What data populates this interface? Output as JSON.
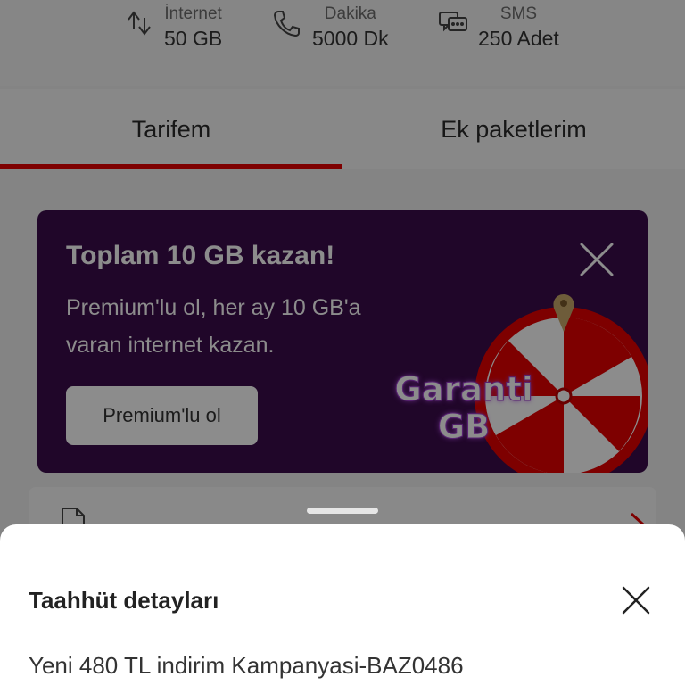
{
  "usage": [
    {
      "label": "İnternet",
      "value": "50 GB",
      "icon": "data-transfer-icon"
    },
    {
      "label": "Dakika",
      "value": "5000 Dk",
      "icon": "phone-icon"
    },
    {
      "label": "SMS",
      "value": "250 Adet",
      "icon": "chat-icon"
    }
  ],
  "tabs": [
    {
      "label": "Tarifem",
      "active": true
    },
    {
      "label": "Ek paketlerim",
      "active": false
    }
  ],
  "promo": {
    "title": "Toplam 10 GB kazan!",
    "description": "Premium'lu ol, her ay 10 GB'a varan internet kazan.",
    "button_label": "Premium'lu ol",
    "badge_line1": "Garanti",
    "badge_line2": "GB",
    "background_color": "#3b0b4c",
    "accent_color": "#e60000"
  },
  "sheet": {
    "title": "Taahhüt detayları",
    "text": "Yeni 480 TL indirim Kampanyasi-BAZ0486"
  },
  "colors": {
    "brand": "#e60000",
    "overlay": "rgba(0,0,0,0.45)"
  }
}
